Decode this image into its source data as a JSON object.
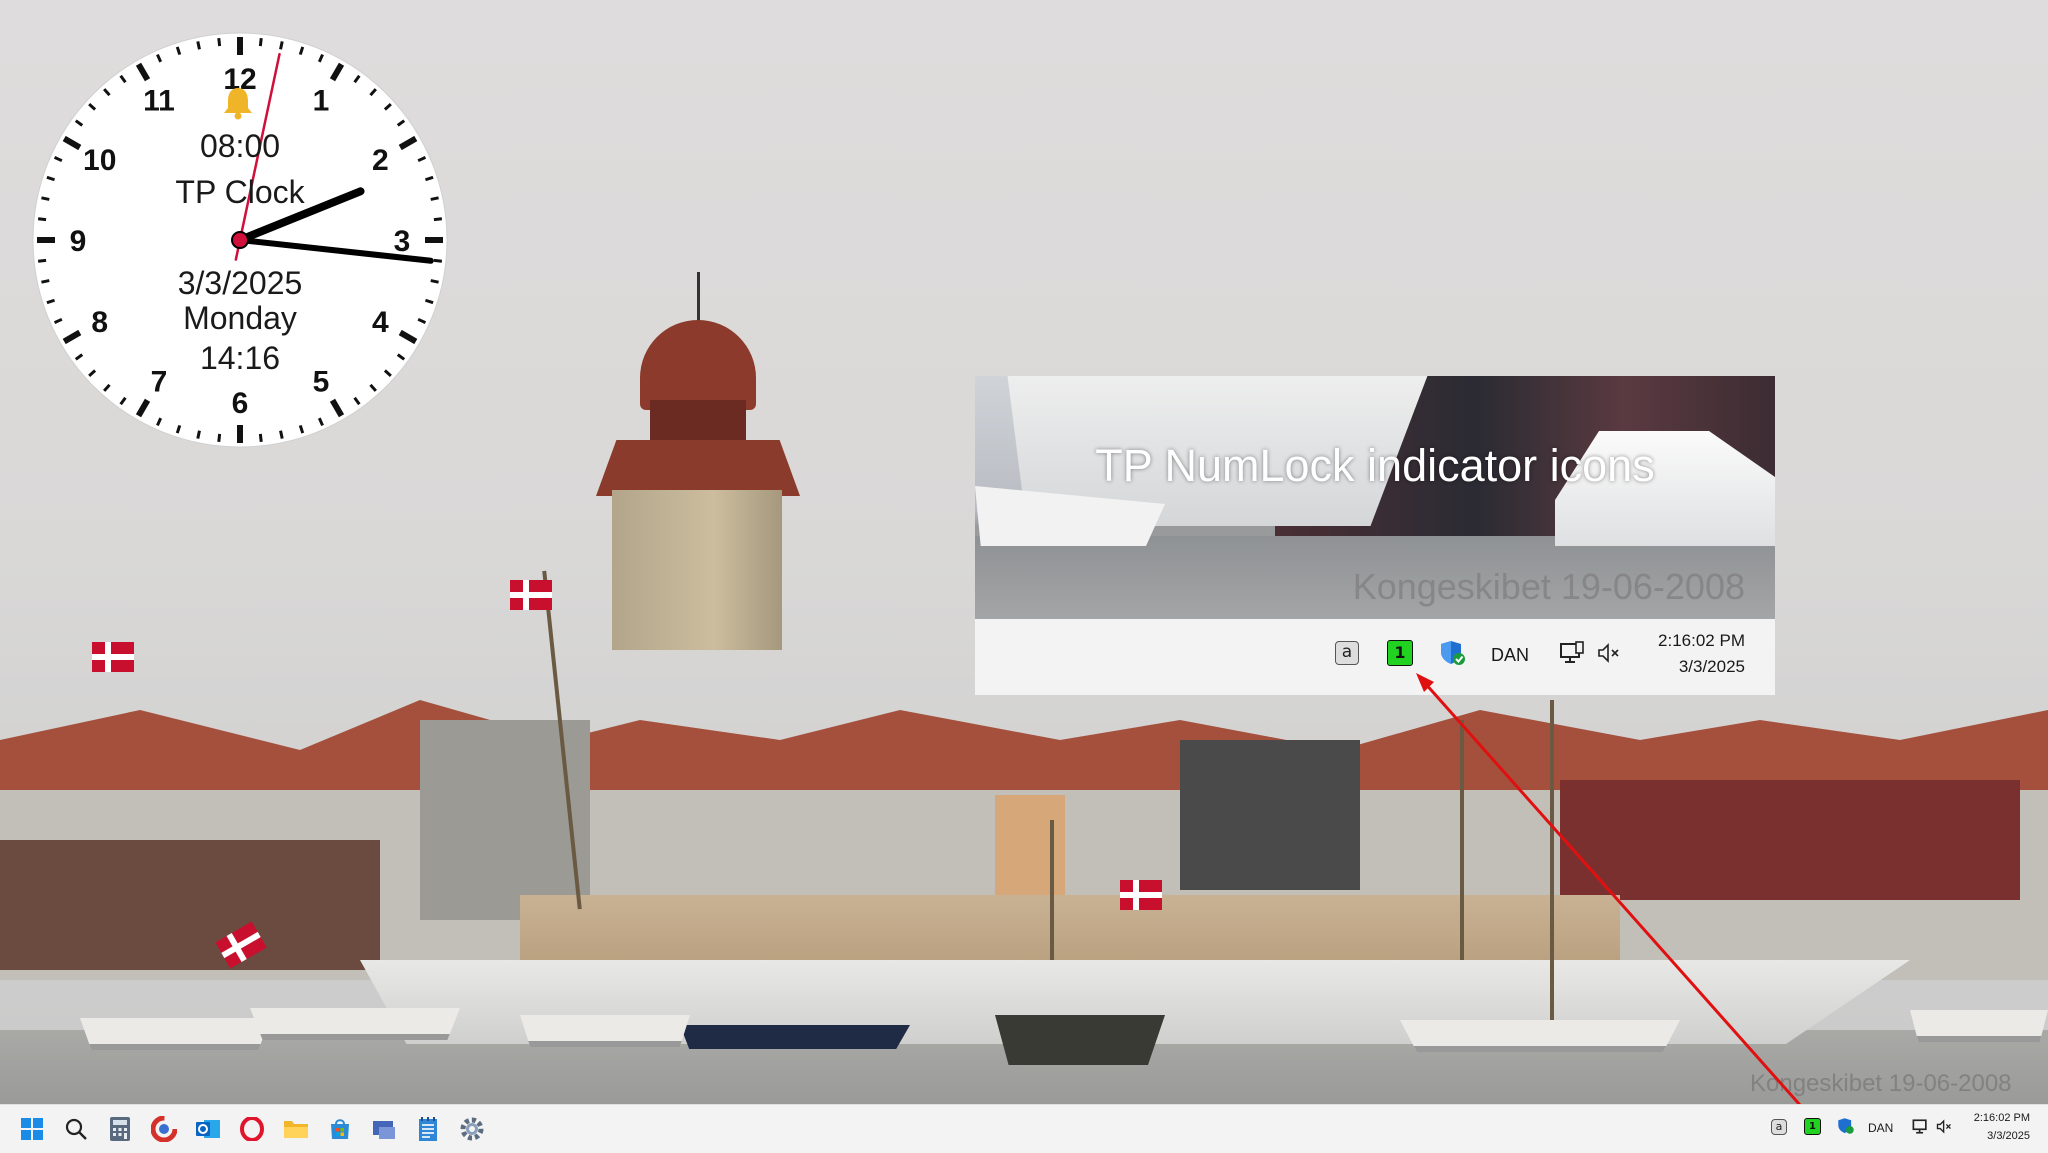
{
  "clock": {
    "numbers": [
      "12",
      "1",
      "2",
      "3",
      "4",
      "5",
      "6",
      "7",
      "8",
      "9",
      "10",
      "11"
    ],
    "alarm_time": "08:00",
    "app_name": "TP Clock",
    "date": "3/3/2025",
    "weekday": "Monday",
    "time_24": "14:16",
    "alarm_icon": "bell-icon",
    "time_shown": {
      "hour": 2,
      "minute": 16,
      "second": 2
    }
  },
  "promo": {
    "title": "TP NumLock indicator icons",
    "watermark": "Kongeskibet 19-06-2008",
    "tray": {
      "keyboard_indicator": "a",
      "numlock_indicator": "1",
      "language": "DAN",
      "time": "2:16:02 PM",
      "date": "3/3/2025"
    }
  },
  "wallpaper": {
    "watermark": "Kongeskibet 19-06-2008"
  },
  "taskbar": {
    "apps": [
      {
        "name": "start-icon"
      },
      {
        "name": "search-icon"
      },
      {
        "name": "calculator-icon"
      },
      {
        "name": "ccleaner-icon"
      },
      {
        "name": "outlook-icon"
      },
      {
        "name": "opera-icon"
      },
      {
        "name": "file-explorer-icon"
      },
      {
        "name": "microsoft-store-icon"
      },
      {
        "name": "remote-desktop-icon"
      },
      {
        "name": "notepad-icon"
      },
      {
        "name": "settings-icon"
      }
    ],
    "tray": {
      "keyboard_indicator": "a",
      "numlock_indicator": "1",
      "language": "DAN",
      "time": "2:16:02 PM",
      "date": "3/3/2025"
    }
  },
  "colors": {
    "numlock_on": "#21d221",
    "arrow": "#e01010",
    "second_hand": "#d0103a"
  }
}
